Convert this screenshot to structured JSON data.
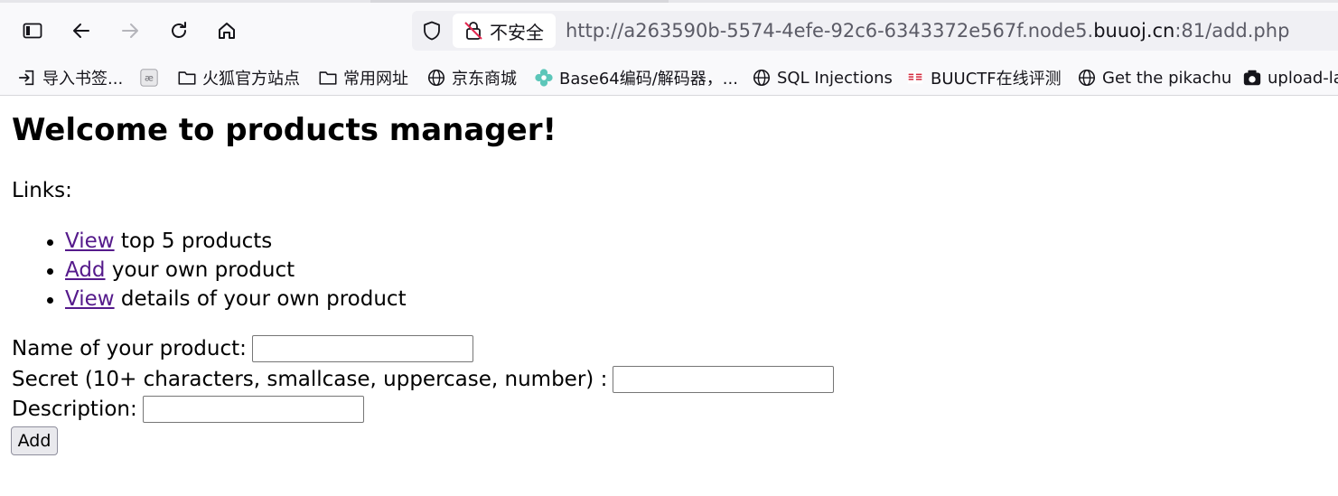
{
  "browser": {
    "security_label": "不安全",
    "url_prefix": "http://a263590b-5574-4efe-92c6-6343372e567f.node5.",
    "url_domain": "buuoj.cn",
    "url_suffix": ":81/add.php",
    "icons": [
      "sidebar-icon",
      "back-icon",
      "forward-icon",
      "reload-icon",
      "home-icon",
      "shield-icon",
      "insecure-lock-icon"
    ]
  },
  "bookmarks": [
    {
      "label": "导入书签...",
      "icon": "import-icon"
    },
    {
      "label": "",
      "icon": "ae-icon"
    },
    {
      "label": "火狐官方站点",
      "icon": "folder-icon"
    },
    {
      "label": "常用网址",
      "icon": "folder-icon"
    },
    {
      "label": "京东商城",
      "icon": "globe-icon"
    },
    {
      "label": "Base64编码/解码器，...",
      "icon": "flower-icon"
    },
    {
      "label": "SQL Injections",
      "icon": "globe-icon"
    },
    {
      "label": "BUUCTF在线评测",
      "icon": "buuctf-icon"
    },
    {
      "label": "Get the pikachu",
      "icon": "globe-icon"
    },
    {
      "label": "upload-la",
      "icon": "upload-icon"
    }
  ],
  "page": {
    "heading": "Welcome to products manager!",
    "links_label": "Links:",
    "links": [
      {
        "link": "View",
        "text": " top 5 products"
      },
      {
        "link": "Add",
        "text": " your own product"
      },
      {
        "link": "View",
        "text": " details of your own product"
      }
    ],
    "form": {
      "name_label": "Name of your product:",
      "name_value": "",
      "secret_label": "Secret (10+ characters, smallcase, uppercase, number) :",
      "secret_value": "",
      "description_label": "Description:",
      "description_value": "",
      "submit_label": "Add"
    }
  },
  "colors": {
    "link_visited": "#551a8b",
    "chrome_bg": "#f9f9fb",
    "urlbar_bg": "#f0f0f4"
  }
}
